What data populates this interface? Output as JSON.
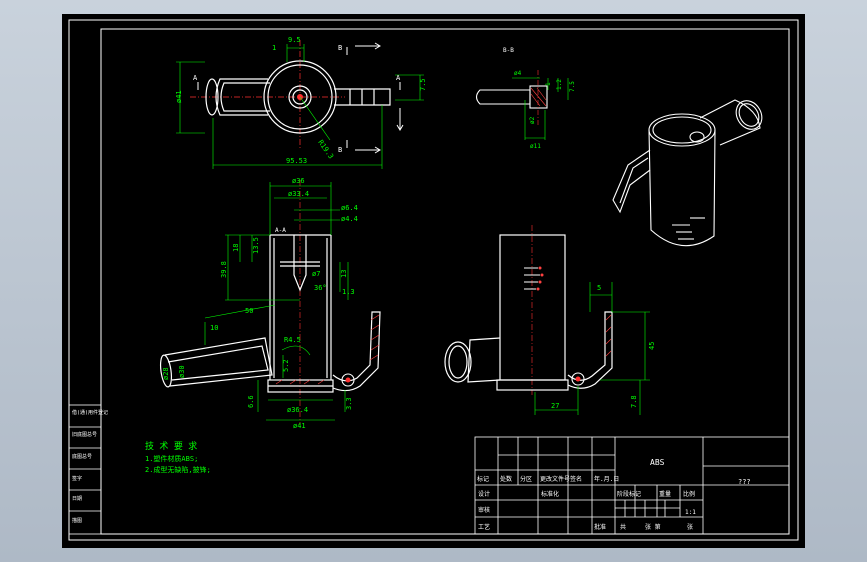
{
  "colors": {
    "background": "#000000",
    "frame": "#ffffff",
    "dimension": "#00ff00",
    "centerline": "#ff3030",
    "part": "#ffffff",
    "hatch": "#ff4040",
    "table_text": "#ffffff"
  },
  "top_view": {
    "dim_width": "9.5",
    "dim_small": "1",
    "dim_height_left": "ø41",
    "dim_height_right": "7.5",
    "dim_radius": "R19.3",
    "dim_overall": "95.53",
    "mark_a_left": "A",
    "mark_a_right": "A",
    "mark_b_top": "B",
    "mark_b_bottom": "B"
  },
  "section_bb": {
    "title": "B-B",
    "dim_d4": "ø4",
    "dim_1": "1",
    "dim_12": "1.2",
    "dim_75": "7.5",
    "dim_d2": "ø2",
    "dim_d11": "ø11"
  },
  "section_aa": {
    "title": "A-A",
    "dim_d36": "ø36",
    "dim_d334": "ø33.4",
    "dim_d64": "ø6.4",
    "dim_d44": "ø4.4",
    "dim_18": "18",
    "dim_135": "13.5",
    "dim_398": "39.8",
    "dim_d7": "ø7",
    "dim_13": "13",
    "dim_13b": "1.3",
    "dim_36": "36°",
    "dim_50": "50",
    "dim_10": "10",
    "dim_d28": "ø28",
    "dim_d30": "ø30",
    "dim_r45": "R4.5",
    "dim_52": "5.2",
    "dim_66": "6.6",
    "dim_33": "3.3",
    "dim_d364": "ø36.4",
    "dim_d41": "ø41"
  },
  "side_view": {
    "dim_top": "5",
    "dim_45": "45",
    "dim_27": "27",
    "dim_78": "7.8"
  },
  "tech_req": {
    "title": "技 术 要 求",
    "line1": "1.塑件材质ABS;",
    "line2": "2.成型无缺陷,披锋;"
  },
  "left_strip": [
    "借(通)用件登记",
    "旧底图总号",
    "底图总号",
    "签字",
    "日期",
    "描图"
  ],
  "title_block": {
    "material": "ABS",
    "drawing_name": "???",
    "row_header": [
      "标记",
      "处数",
      "分区",
      "更改文件号",
      "签名",
      "年.月.日"
    ],
    "design": "设计",
    "standardize": "标准化",
    "stage_mark": "阶段标记",
    "weight": "重量",
    "scale": "比例",
    "check": "审核",
    "process": "工艺",
    "approve": "批准",
    "scale_value": "1:1",
    "sheets_total": "共",
    "sheet_no": "张 第",
    "sheet_suffix": "张"
  }
}
